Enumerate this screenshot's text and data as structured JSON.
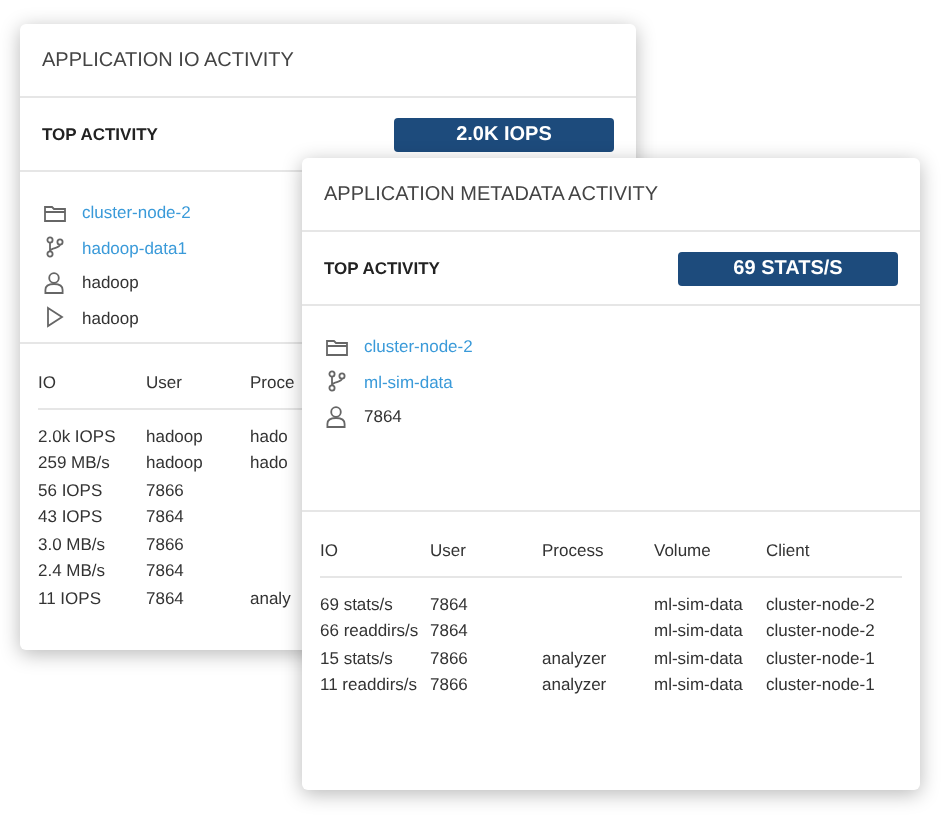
{
  "io_panel": {
    "title": "APPLICATION IO ACTIVITY",
    "top_activity": {
      "label": "TOP ACTIVITY",
      "value": "2.0K IOPS"
    },
    "details": [
      {
        "kind": "folder",
        "text": "cluster-node-2",
        "link": true
      },
      {
        "kind": "branch",
        "text": "hadoop-data1",
        "link": true
      },
      {
        "kind": "user",
        "text": "hadoop",
        "link": false
      },
      {
        "kind": "process",
        "text": "hadoop",
        "link": false
      }
    ],
    "table": {
      "columns": [
        "IO",
        "User",
        "Proce"
      ],
      "rows": [
        [
          "2.0k IOPS",
          "hadoop",
          "hado"
        ],
        [
          "259 MB/s",
          "hadoop",
          "hado"
        ],
        [
          "56 IOPS",
          "7866",
          ""
        ],
        [
          "43 IOPS",
          "7864",
          ""
        ],
        [
          "3.0 MB/s",
          "7866",
          ""
        ],
        [
          "2.4 MB/s",
          "7864",
          ""
        ],
        [
          "11 IOPS",
          "7864",
          "analy"
        ]
      ]
    }
  },
  "metadata_panel": {
    "title": "APPLICATION METADATA ACTIVITY",
    "top_activity": {
      "label": "TOP ACTIVITY",
      "value": "69 STATS/S"
    },
    "details": [
      {
        "kind": "folder",
        "text": "cluster-node-2",
        "link": true
      },
      {
        "kind": "branch",
        "text": "ml-sim-data",
        "link": true
      },
      {
        "kind": "user",
        "text": "7864",
        "link": false
      }
    ],
    "table": {
      "columns": [
        "IO",
        "User",
        "Process",
        "Volume",
        "Client"
      ],
      "rows": [
        [
          "69 stats/s",
          "7864",
          "",
          "ml-sim-data",
          "cluster-node-2"
        ],
        [
          "66 readdirs/s",
          "7864",
          "",
          "ml-sim-data",
          "cluster-node-2"
        ],
        [
          "15 stats/s",
          "7866",
          "analyzer",
          "ml-sim-data",
          "cluster-node-1"
        ],
        [
          "11 readdirs/s",
          "7866",
          "analyzer",
          "ml-sim-data",
          "cluster-node-1"
        ]
      ]
    }
  }
}
